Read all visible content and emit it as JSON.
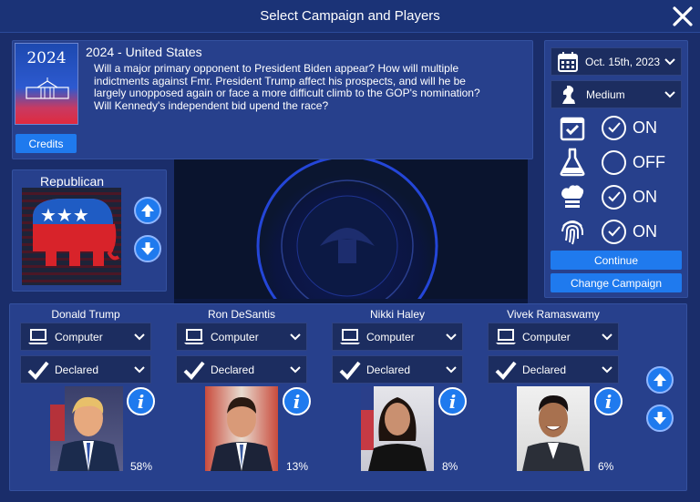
{
  "window": {
    "title": "Select Campaign and Players"
  },
  "scenario": {
    "year": "2024",
    "title": "2024 - United States",
    "description": "Will a major primary opponent to President Biden appear? How will multiple indictments against Fmr. President Trump affect his prospects, and will he be largely unopposed again or face a more difficult climb to the GOP's nomination? Will Kennedy's independent bid upend the race?",
    "credits_label": "Credits"
  },
  "party": {
    "name": "Republican"
  },
  "settings": {
    "date": "Oct. 15th, 2023",
    "difficulty": "Medium",
    "toggles": [
      {
        "icon": "calendar-check-icon",
        "state": "ON"
      },
      {
        "icon": "flask-icon",
        "state": "OFF"
      },
      {
        "icon": "chef-hat-icon",
        "state": "ON"
      },
      {
        "icon": "fingerprint-icon",
        "state": "ON"
      }
    ],
    "continue_label": "Continue",
    "change_campaign_label": "Change Campaign"
  },
  "players": [
    {
      "name": "Donald Trump",
      "control": "Computer",
      "status": "Declared",
      "percent": "58%"
    },
    {
      "name": "Ron DeSantis",
      "control": "Computer",
      "status": "Declared",
      "percent": "13%"
    },
    {
      "name": "Nikki Haley",
      "control": "Computer",
      "status": "Declared",
      "percent": "8%"
    },
    {
      "name": "Vivek Ramaswamy",
      "control": "Computer",
      "status": "Declared",
      "percent": "6%"
    }
  ],
  "colors": {
    "accent": "#1f7aee",
    "panel": "#27408c",
    "background": "#1a2d6a"
  }
}
